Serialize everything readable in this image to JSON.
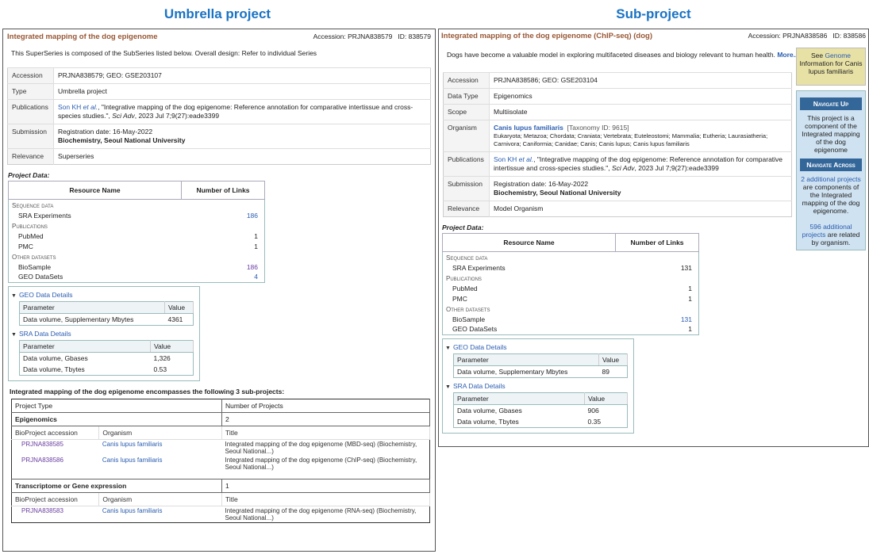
{
  "labels": {
    "left": "Umbrella project",
    "right": "Sub-project"
  },
  "left": {
    "title": "Integrated mapping of the dog epigenome",
    "accession": "Accession: PRJNA838579",
    "id": "ID: 838579",
    "description": "This SuperSeries is composed of the SubSeries listed below. Overall design: Refer to individual Series",
    "info": {
      "accession_k": "Accession",
      "accession_v": "PRJNA838579; GEO: GSE203107",
      "type_k": "Type",
      "type_v": "Umbrella project",
      "pub_k": "Publications",
      "pub_author": "Son KH ",
      "pub_etal": "et al.",
      "pub_text": ", \"Integrative mapping of the dog epigenome: Reference annotation for comparative intertissue and cross-species studies.\", ",
      "pub_journal": "Sci Adv",
      "pub_date": ", 2023 Jul 7;9(27):eade3399",
      "sub_k": "Submission",
      "sub_date": "Registration date: 16-May-2022",
      "sub_org": "Biochemistry, Seoul National University",
      "rel_k": "Relevance",
      "rel_v": "Superseries"
    },
    "project_data": "Project Data:",
    "resources": {
      "h1": "Resource Name",
      "h2": "Number of Links",
      "seq": "Sequence data",
      "sra": "SRA Experiments",
      "sra_n": "186",
      "pubs": "Publications",
      "pubmed": "PubMed",
      "pubmed_n": "1",
      "pmc": "PMC",
      "pmc_n": "1",
      "other": "Other datasets",
      "biosample": "BioSample",
      "biosample_n": "186",
      "geo": "GEO DataSets",
      "geo_n": "4"
    },
    "geo_details": {
      "title": "GEO Data Details",
      "h1": "Parameter",
      "h2": "Value",
      "p1": "Data volume, Supplementary Mbytes",
      "v1": "4361"
    },
    "sra_details": {
      "title": "SRA Data Details",
      "h1": "Parameter",
      "h2": "Value",
      "p1": "Data volume, Gbases",
      "v1": "1,326",
      "p2": "Data volume, Tbytes",
      "v2": "0.53"
    },
    "subprojects": {
      "header": "Integrated mapping of the dog epigenome encompasses the following 3 sub-projects:",
      "h_type": "Project Type",
      "h_num": "Number of Projects",
      "cat1": "Epigenomics",
      "cat1_n": "2",
      "col_acc": "BioProject accession",
      "col_org": "Organism",
      "col_title": "Title",
      "items1": [
        {
          "acc": "PRJNA838585",
          "org": "Canis lupus familiaris",
          "title": "Integrated mapping of the dog epigenome (MBD-seq) (Biochemistry, Seoul National...)"
        },
        {
          "acc": "PRJNA838586",
          "org": "Canis lupus familiaris",
          "title": "Integrated mapping of the dog epigenome (ChIP-seq) (Biochemistry, Seoul National...)"
        }
      ],
      "cat2": "Transcriptome or Gene expression",
      "cat2_n": "1",
      "items2": [
        {
          "acc": "PRJNA838583",
          "org": "Canis lupus familiaris",
          "title": "Integrated mapping of the dog epigenome (RNA-seq) (Biochemistry, Seoul National...)"
        }
      ]
    }
  },
  "right": {
    "title": "Integrated mapping of the dog epigenome (ChIP-seq) (dog)",
    "accession": "Accession: PRJNA838586",
    "id": "ID: 838586",
    "description": "Dogs have become a valuable model in exploring multifaceted diseases and biology relevant to human health.",
    "more": "More...",
    "info": {
      "accession_k": "Accession",
      "accession_v": "PRJNA838586; GEO: GSE203104",
      "dtype_k": "Data Type",
      "dtype_v": "Epigenomics",
      "scope_k": "Scope",
      "scope_v": "Multiisolate",
      "org_k": "Organism",
      "org_name": "Canis lupus familiaris",
      "org_tax": "[Taxonomy ID: 9615]",
      "org_lineage": "Eukaryota; Metazoa; Chordata; Craniata; Vertebrata; Euteleostomi; Mammalia; Eutheria; Laurasiatheria; Carnivora; Caniformia; Canidae; Canis; Canis lupus; Canis lupus familiaris",
      "pub_k": "Publications",
      "pub_author": "Son KH ",
      "pub_etal": "et al.",
      "pub_text": ", \"Integrative mapping of the dog epigenome: Reference annotation for comparative intertissue and cross-species studies.\", ",
      "pub_journal": "Sci Adv",
      "pub_date": ", 2023 Jul 7;9(27):eade3399",
      "sub_k": "Submission",
      "sub_date": "Registration date: 16-May-2022",
      "sub_org": "Biochemistry, Seoul National University",
      "rel_k": "Relevance",
      "rel_v": "Model Organism"
    },
    "project_data": "Project Data:",
    "resources": {
      "h1": "Resource Name",
      "h2": "Number of Links",
      "seq": "Sequence data",
      "sra": "SRA Experiments",
      "sra_n": "131",
      "pubs": "Publications",
      "pubmed": "PubMed",
      "pubmed_n": "1",
      "pmc": "PMC",
      "pmc_n": "1",
      "other": "Other datasets",
      "biosample": "BioSample",
      "biosample_n": "131",
      "geo": "GEO DataSets",
      "geo_n": "1"
    },
    "geo_details": {
      "title": "GEO Data Details",
      "h1": "Parameter",
      "h2": "Value",
      "p1": "Data volume, Supplementary Mbytes",
      "v1": "89"
    },
    "sra_details": {
      "title": "SRA Data Details",
      "h1": "Parameter",
      "h2": "Value",
      "p1": "Data volume, Gbases",
      "v1": "906",
      "p2": "Data volume, Tbytes",
      "v2": "0.35"
    }
  },
  "sidebar": {
    "see_pre": "See ",
    "see_link": "Genome",
    "see_post": " Information for Canis lupus familiaris",
    "nav_up": "Navigate Up",
    "nav_up_text": "This project is a component of the Integrated mapping of the dog epigenome",
    "nav_across": "Navigate Across",
    "across_link": "2 additional projects",
    "across_text": " are components of the Integrated mapping of the dog epigenome.",
    "related_link": "596 additional projects",
    "related_text": " are related by organism."
  }
}
